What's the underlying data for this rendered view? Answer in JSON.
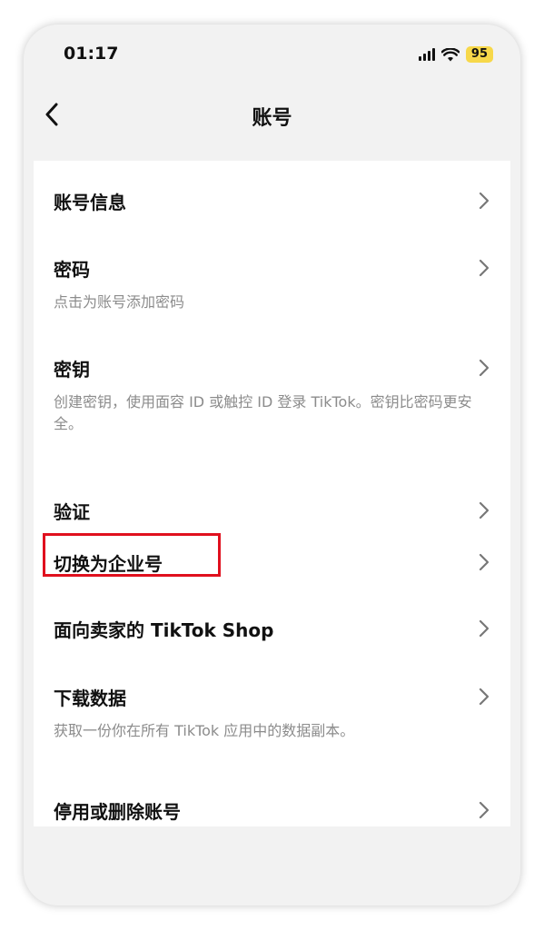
{
  "status_bar": {
    "time": "01:17",
    "battery": "95"
  },
  "nav": {
    "title": "账号"
  },
  "items": [
    {
      "title": "账号信息",
      "desc": ""
    },
    {
      "title": "密码",
      "desc": "点击为账号添加密码"
    },
    {
      "title": "密钥",
      "desc": "创建密钥，使用面容 ID 或触控 ID 登录 TikTok。密钥比密码更安全。"
    },
    {
      "title": "验证",
      "desc": ""
    },
    {
      "title": "切换为企业号",
      "desc": ""
    },
    {
      "title": "面向卖家的 TikTok Shop",
      "desc": ""
    },
    {
      "title": "下载数据",
      "desc": "获取一份你在所有 TikTok 应用中的数据副本。"
    },
    {
      "title": "停用或删除账号",
      "desc": ""
    }
  ],
  "colors": {
    "highlight": "#e0101e",
    "battery": "#f7d84a"
  },
  "icons": [
    "back-chevron-icon",
    "signal-icon",
    "wifi-icon",
    "battery-icon",
    "chevron-right-icon"
  ]
}
